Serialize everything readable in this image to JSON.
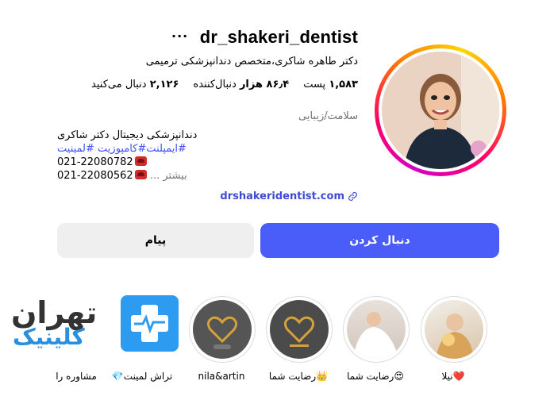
{
  "profile": {
    "username": "dr_shakeri_dentist",
    "more_icon": "ellipsis-icon",
    "full_name": "دکتر طاهره شاکری،متخصص دندانپزشکی ترمیمی",
    "stats": {
      "posts_value": "۱,۵۸۳",
      "posts_label": "پست",
      "followers_value": "۸۶٫۴ هزار",
      "followers_label": "دنبال‌کننده",
      "following_value": "۲,۱۲۶",
      "following_label": "دنبال می‌کنید"
    },
    "category": "سلامت/زیبایی",
    "bio": {
      "line1": "دندانپزشکی دیجیتال دکتر شاکری",
      "hashtags": "#ایمپلنت#کامپوزیت #لمینیت",
      "phone1": "021-22080782",
      "phone2": "021-22080562",
      "more": "... بیشتر"
    },
    "link": "drshakeridentist.com",
    "link_icon": "link-icon"
  },
  "actions": {
    "follow_label": "دنبال کردن",
    "message_label": "پیام"
  },
  "highlights": [
    {
      "label": "نیلا❤️"
    },
    {
      "label": "رضایت شما😍"
    },
    {
      "label": "رضایت شما👑"
    },
    {
      "label": "nila&artin"
    },
    {
      "label": "💎تراش لمینت"
    },
    {
      "label": "مشاوره را"
    }
  ],
  "brand": {
    "line1": "تهران",
    "line2": "کلینیک",
    "icon": "medical-plus-icon",
    "color": "#2d9cf0"
  },
  "colors": {
    "follow_button": "#4a5df9",
    "message_button": "#efefef",
    "hashtag": "#4150f7",
    "link": "#3f4bd0"
  }
}
